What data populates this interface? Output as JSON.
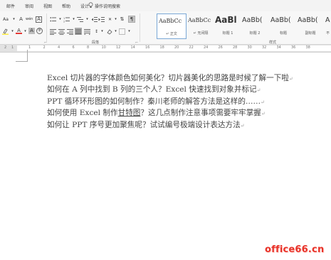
{
  "menu": {
    "items": [
      "邮件",
      "审阅",
      "视图",
      "帮助",
      "设计"
    ],
    "tell_me": "操作说明搜索"
  },
  "ribbon": {
    "font_size_btn": "Aa",
    "font_clear_btn": "A",
    "phonetic_btn": "wén",
    "border_char_btn": "A",
    "char_shading_btn": "A",
    "font_color_btn": "A",
    "circled_char_btn": "字",
    "paragraph_group_label": "段落",
    "styles_group_label": "样式",
    "styles": [
      {
        "preview": "AaBbCc",
        "name": "正文"
      },
      {
        "preview": "AaBbCc",
        "name": "无间隔"
      },
      {
        "preview": "AaBl",
        "name": "标题 1"
      },
      {
        "preview": "AaBb(",
        "name": "标题 2"
      },
      {
        "preview": "AaBb(",
        "name": "标题"
      },
      {
        "preview": "AaBb(",
        "name": "副标题"
      },
      {
        "preview": "A",
        "name": "不"
      }
    ],
    "accent_color": "#7aa7d6",
    "font_color_underline": "#e53935",
    "highlight_color": "#ffeb3b"
  },
  "ruler": {
    "numbers": [
      "2",
      "1",
      "1",
      "2",
      "4",
      "6",
      "8",
      "10",
      "12",
      "14",
      "16",
      "18",
      "20",
      "22",
      "24",
      "26",
      "28",
      "30",
      "32",
      "34",
      "36",
      "38"
    ]
  },
  "document": {
    "lines": [
      {
        "text": "Excel 切片器的字体颜色如何美化？切片器美化的思路是时候了解一下啦",
        "mark": "↵"
      },
      {
        "text": "如何在 A 列中找到 B 列的三个人？Excel 快速找到对象并标记",
        "mark": "↵"
      },
      {
        "text": "PPT 循环环形图的如何制作？秦川老师的解答方法是这样的……",
        "mark": "↵"
      },
      {
        "pre": "如何使用 Excel 制作",
        "underlined": "甘特图",
        "post": "？这几点制作注意事项需要牢牢掌握",
        "mark": "↵"
      },
      {
        "text": "如何让 PPT 序号更加聚焦呢？试试编号极端设计表达方法",
        "mark": "↵"
      }
    ]
  },
  "watermark": "office66.cn"
}
